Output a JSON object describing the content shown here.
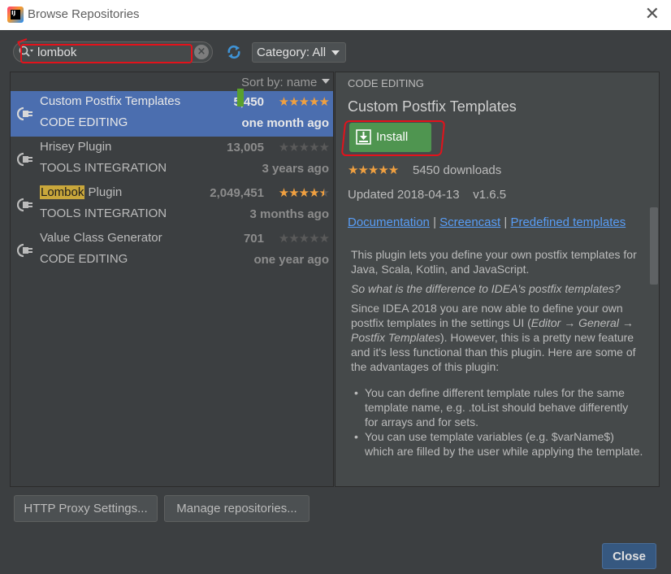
{
  "window": {
    "title": "Browse Repositories",
    "app_icon_text": "IJ"
  },
  "search": {
    "value": "lombok"
  },
  "category": {
    "label": "Category: All"
  },
  "list": {
    "sort_label": "Sort by: name",
    "plugins": [
      {
        "name": "Custom Postfix Templates",
        "category": "CODE EDITING",
        "downloads": "5,450",
        "date": "one month ago",
        "stars": 5,
        "selected": true
      },
      {
        "name": "Hrisey Plugin",
        "category": "TOOLS INTEGRATION",
        "downloads": "13,005",
        "date": "3 years ago",
        "stars": 0
      },
      {
        "name_highlight": "Lombok",
        "name_rest": " Plugin",
        "category": "TOOLS INTEGRATION",
        "downloads": "2,049,451",
        "date": "3 months ago",
        "stars": 4.5
      },
      {
        "name": "Value Class Generator",
        "category": "CODE EDITING",
        "downloads": "701",
        "date": "one year ago",
        "stars": 0
      }
    ]
  },
  "detail": {
    "category": "CODE EDITING",
    "title": "Custom Postfix Templates",
    "install_label": "Install",
    "stars": 5,
    "downloads": "5450 downloads",
    "updated": "Updated 2018-04-13",
    "version": "v1.6.5",
    "links": [
      "Documentation",
      "Screencast",
      "Predefined templates"
    ],
    "separator": "|",
    "desc_p1": "This plugin lets you define your own postfix templates for Java, Scala, Kotlin, and JavaScript.",
    "desc_q": "So what is the difference to IDEA's postfix templates?",
    "desc_p2_a": "Since IDEA 2018 you are now able to define your own postfix templates in the settings UI (",
    "desc_p2_i": "Editor → General → Postfix Templates",
    "desc_p2_b": "). However, this is a pretty new feature and it's less functional than this plugin. Here are some of the advantages of this plugin:",
    "bullets": [
      "You can define different template rules for the same template name, e.g. .toList should behave differently for arrays and for sets.",
      "You can use template variables (e.g. $varName$) which are filled by the user while applying the template."
    ]
  },
  "buttons": {
    "proxy": "HTTP Proxy Settings...",
    "repos": "Manage repositories...",
    "close": "Close"
  },
  "colors": {
    "accent_selection": "#4b6eaf",
    "install_green": "#4f9550",
    "link_blue": "#589df6",
    "star_orange": "#f0a040",
    "annotation_red": "#e3121b"
  }
}
